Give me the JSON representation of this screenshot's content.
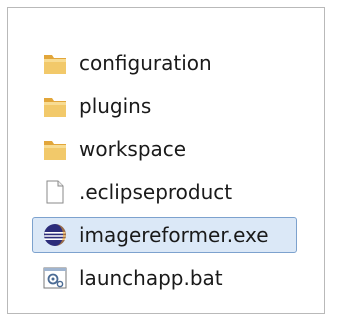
{
  "items": [
    {
      "label": "configuration",
      "icon": "folder-icon",
      "kind": "folder"
    },
    {
      "label": "plugins",
      "icon": "folder-icon",
      "kind": "folder"
    },
    {
      "label": "workspace",
      "icon": "folder-icon",
      "kind": "folder"
    },
    {
      "label": ".eclipseproduct",
      "icon": "document-icon",
      "kind": "file"
    },
    {
      "label": "imagereformer.exe",
      "icon": "eclipse-icon",
      "kind": "file",
      "selected": true
    },
    {
      "label": "launchapp.bat",
      "icon": "batch-file-icon",
      "kind": "file"
    }
  ],
  "colors": {
    "folder": "#e8b64a",
    "selection_bg": "#dbe8f7",
    "selection_border": "#7da2ce"
  }
}
